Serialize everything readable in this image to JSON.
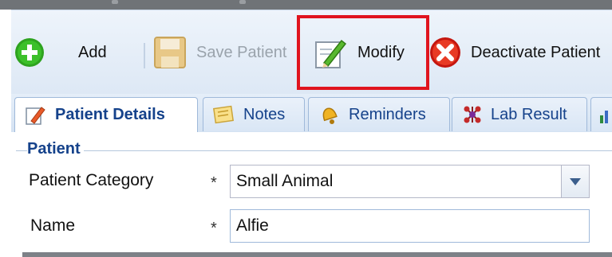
{
  "toolbar": {
    "add_label": "Add",
    "save_label": "Save Patient",
    "modify_label": "Modify",
    "deactivate_label": "Deactivate Patient"
  },
  "tabs": [
    {
      "label": "Patient Details",
      "icon": "edit-document-icon",
      "active": true
    },
    {
      "label": "Notes",
      "icon": "notes-icon"
    },
    {
      "label": "Reminders",
      "icon": "bell-icon"
    },
    {
      "label": "Lab Result",
      "icon": "molecule-icon"
    }
  ],
  "form": {
    "legend": "Patient",
    "required_marker": "*",
    "category": {
      "label": "Patient Category",
      "value": "Small Animal"
    },
    "name": {
      "label": "Name",
      "value": "Alfie"
    }
  },
  "colors": {
    "highlight": "#e0141e",
    "tab_text": "#15428b",
    "add_icon": "#2ea31f",
    "deactivate_icon": "#e02a1a"
  }
}
